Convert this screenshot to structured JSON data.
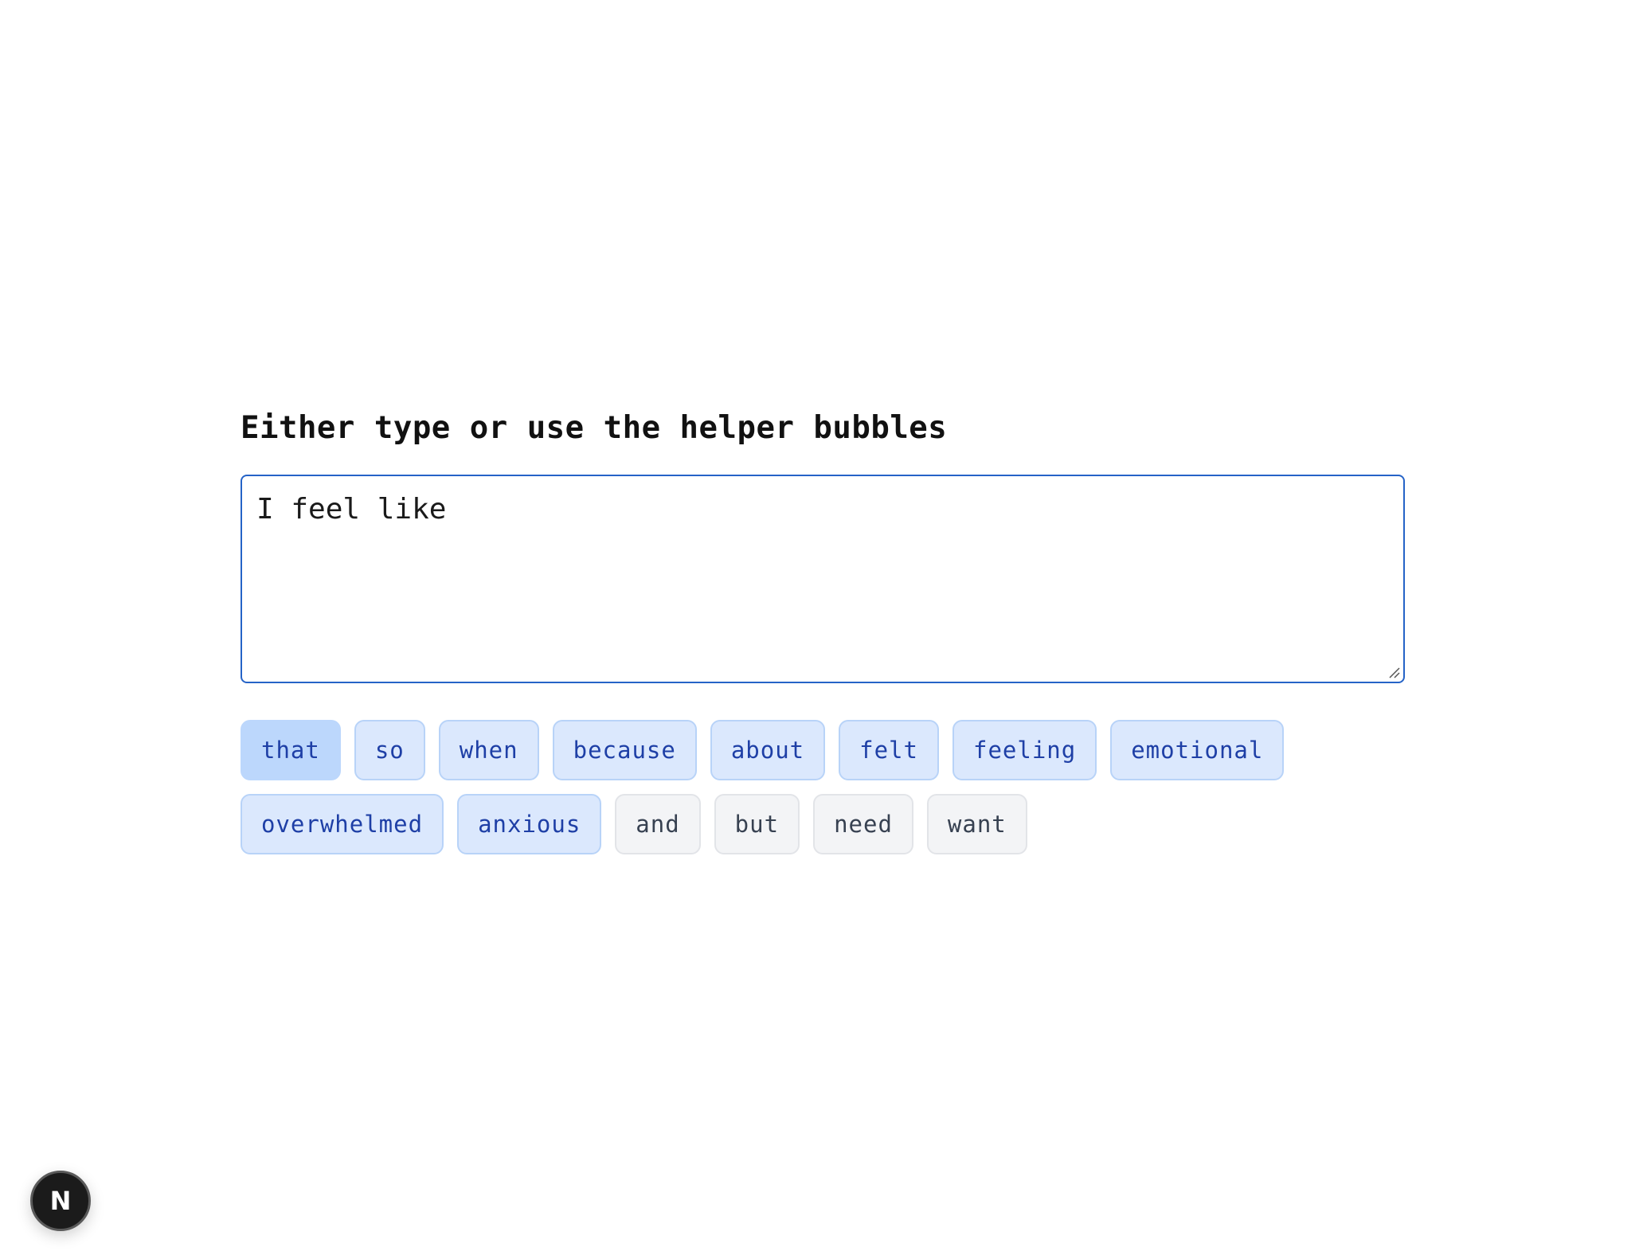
{
  "heading": "Either type or use the helper bubbles",
  "editor": {
    "value": "I feel like"
  },
  "bubbles": {
    "row1": [
      {
        "label": "that",
        "kind": "emotion",
        "active": true
      },
      {
        "label": "so",
        "kind": "emotion"
      },
      {
        "label": "when",
        "kind": "emotion"
      },
      {
        "label": "because",
        "kind": "emotion"
      },
      {
        "label": "about",
        "kind": "emotion"
      },
      {
        "label": "felt",
        "kind": "emotion"
      },
      {
        "label": "feeling",
        "kind": "emotion"
      },
      {
        "label": "emotional",
        "kind": "emotion"
      }
    ],
    "row2": [
      {
        "label": "overwhelmed",
        "kind": "emotion"
      },
      {
        "label": "anxious",
        "kind": "emotion"
      },
      {
        "label": "and",
        "kind": "neutral"
      },
      {
        "label": "but",
        "kind": "neutral"
      },
      {
        "label": "need",
        "kind": "neutral"
      },
      {
        "label": "want",
        "kind": "neutral"
      }
    ]
  },
  "devtools_badge": {
    "label": "N"
  },
  "colors": {
    "accent_border": "#2563c7",
    "emotion_bg": "#dbe8fd",
    "emotion_active_bg": "#bcd7fc",
    "emotion_text": "#1e3fa6",
    "neutral_bg": "#f3f4f6",
    "neutral_text": "#374151"
  }
}
